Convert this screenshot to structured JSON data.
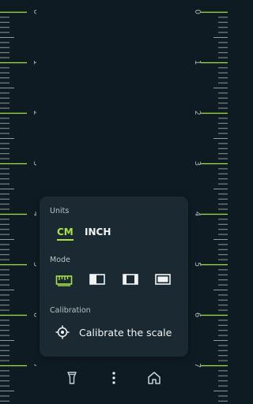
{
  "ruler": {
    "left_numbers": [
      "0",
      "1",
      "2",
      "3",
      "4",
      "5",
      "6",
      "7"
    ],
    "right_numbers": [
      "0",
      "1",
      "2",
      "3",
      "4",
      "5",
      "6",
      "7"
    ],
    "tick_color": "#8a9aa0",
    "accent_tick_color": "#a8e04a"
  },
  "panel": {
    "units_label": "Units",
    "units": [
      {
        "label": "CM",
        "selected": true
      },
      {
        "label": "INCH",
        "selected": false
      }
    ],
    "mode_label": "Mode",
    "modes": [
      {
        "icon": "ruler-mode-icon",
        "selected": true
      },
      {
        "icon": "half-left-mode-icon",
        "selected": false
      },
      {
        "icon": "center-mode-icon",
        "selected": false
      },
      {
        "icon": "full-frame-mode-icon",
        "selected": false
      }
    ],
    "calibration_label": "Calibration",
    "calibrate_text": "Calibrate the scale"
  },
  "bottom_bar": {
    "icons": [
      "flashlight-icon",
      "more-vertical-icon",
      "home-icon"
    ]
  },
  "colors": {
    "background": "#0f1b22",
    "panel": "#1b2a32",
    "accent": "#a8e04a",
    "text": "#f2f4f4"
  }
}
